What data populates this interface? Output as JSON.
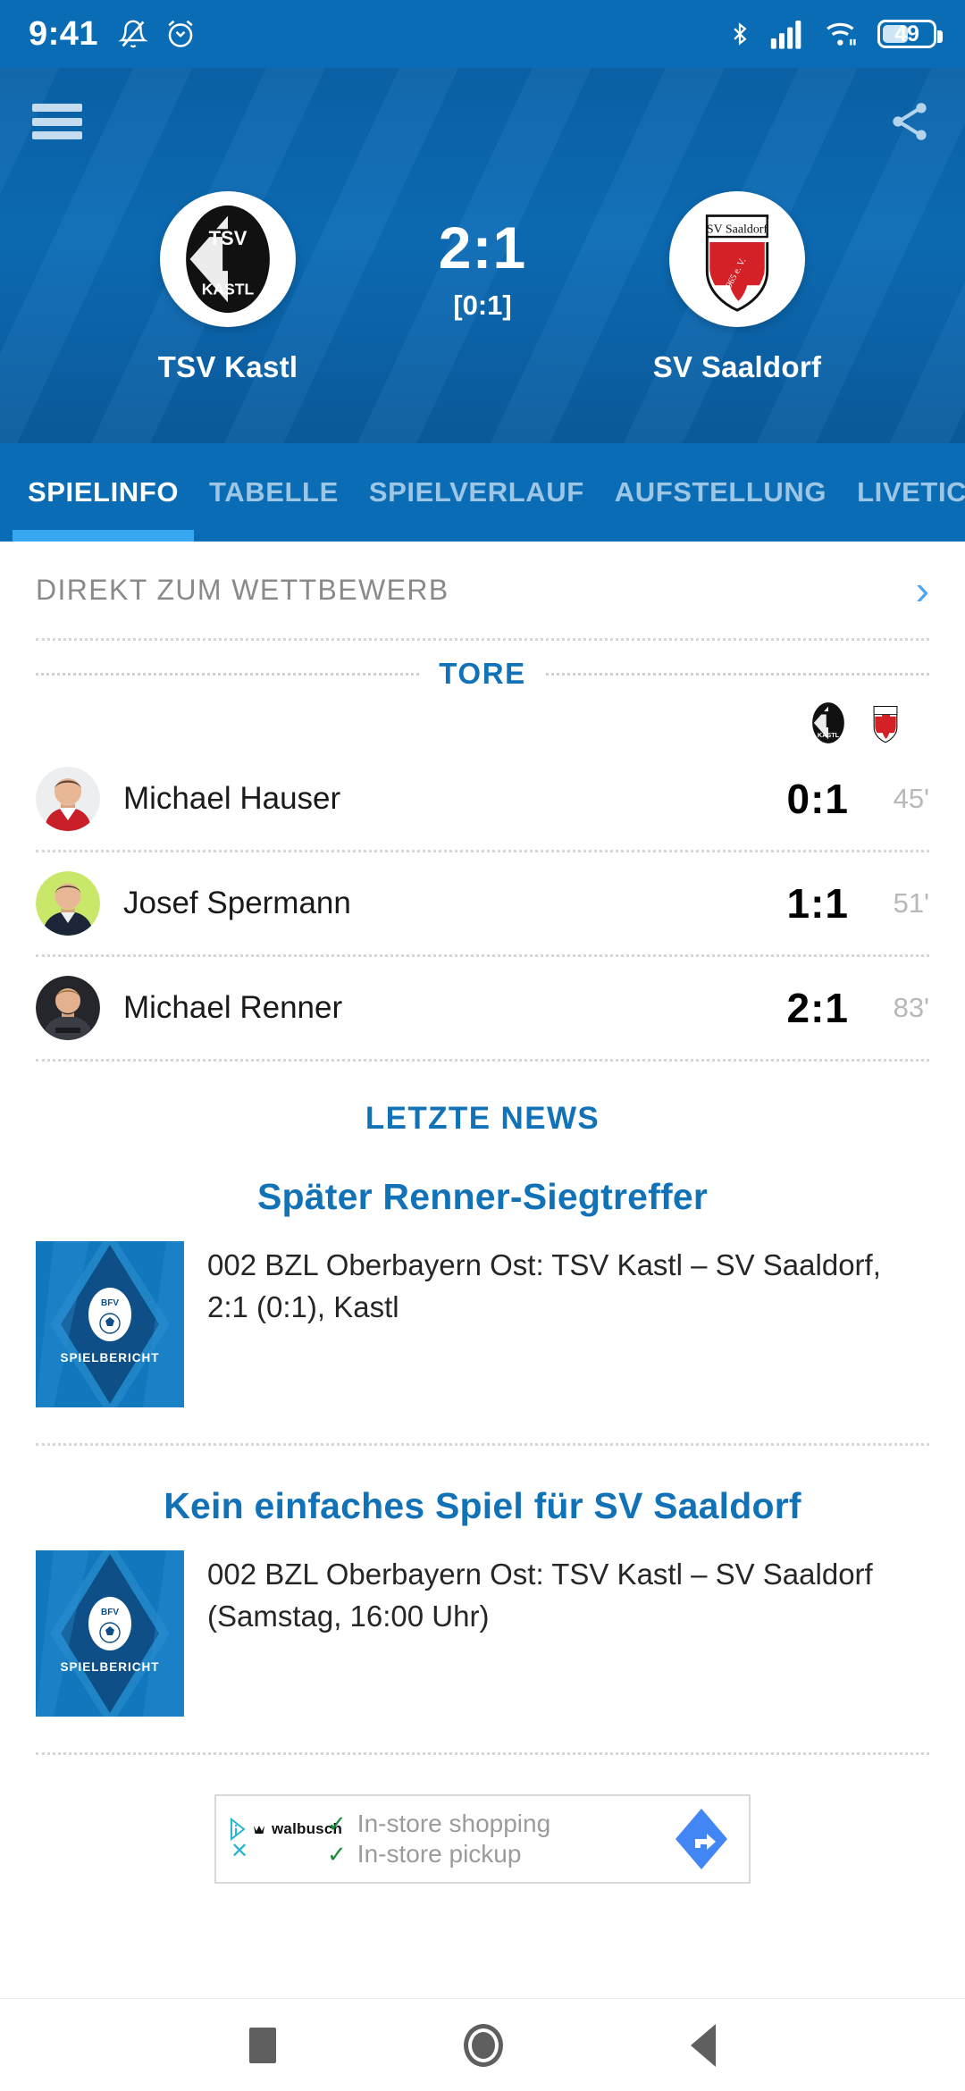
{
  "status_bar": {
    "time": "9:41",
    "icons_left": [
      "notifications-silenced-icon",
      "alarm-icon"
    ],
    "icons_right": [
      "bluetooth-icon",
      "signal-icon",
      "wifi-icon",
      "battery-icon"
    ],
    "battery_level": "49"
  },
  "header": {
    "menu_icon": "hamburger-menu-icon",
    "share_icon": "share-icon",
    "home_team": {
      "name": "TSV Kastl",
      "crest": "tsv-kastl-crest",
      "crest_label_top": "TSV",
      "crest_label_bottom": "KASTL"
    },
    "away_team": {
      "name": "SV Saaldorf",
      "crest": "sv-saaldorf-crest",
      "crest_label_top": "SV Saaldorf",
      "crest_label_bottom": "1965 e. V."
    },
    "score": "2:1",
    "halftime_score": "[0:1]",
    "accent_color": "#0a6cb4",
    "tab_indicator_color": "#36a7f0"
  },
  "tabs": [
    {
      "label": "SPIELINFO",
      "active": true
    },
    {
      "label": "TABELLE",
      "active": false
    },
    {
      "label": "SPIELVERLAUF",
      "active": false
    },
    {
      "label": "AUFSTELLUNG",
      "active": false
    },
    {
      "label": "LIVETICKER",
      "active": false
    }
  ],
  "competition_link": {
    "label": "DIREKT ZUM WETTBEWERB",
    "chevron": "›"
  },
  "goals_section": {
    "title": "TORE",
    "title_color": "#1272b8",
    "crest_home": "tsv-kastl-mini-crest",
    "crest_away": "sv-saaldorf-mini-crest",
    "rows": [
      {
        "player": "Michael Hauser",
        "score": "0:1",
        "minute": "45'",
        "avatar": "player-avatar-hauser"
      },
      {
        "player": "Josef Spermann",
        "score": "1:1",
        "minute": "51'",
        "avatar": "player-avatar-spermann"
      },
      {
        "player": "Michael Renner",
        "score": "2:1",
        "minute": "83'",
        "avatar": "player-avatar-renner"
      }
    ]
  },
  "news_section": {
    "title": "LETZTE NEWS",
    "items": [
      {
        "headline": "Später Renner-Siegtreffer",
        "text": "002 BZL Oberbayern Ost: TSV Kastl – SV Saaldorf, 2:1 (0:1), Kastl",
        "thumb_label": "SPIELBERICHT",
        "thumb_logo": "bfv-logo"
      },
      {
        "headline": "Kein einfaches Spiel für SV Saaldorf",
        "text": "002 BZL Oberbayern Ost: TSV Kastl – SV Saaldorf (Samstag, 16:00 Uhr)",
        "thumb_label": "SPIELBERICHT",
        "thumb_logo": "bfv-logo"
      }
    ]
  },
  "ad": {
    "brand": "walbusch",
    "close_label": "✕",
    "line1": "In-store shopping",
    "line2": "In-store pickup",
    "check": "✓",
    "cta_icon": "directions-arrow-icon"
  },
  "nav_bar": {
    "recents": "recents-button",
    "home": "home-button",
    "back": "back-button"
  }
}
